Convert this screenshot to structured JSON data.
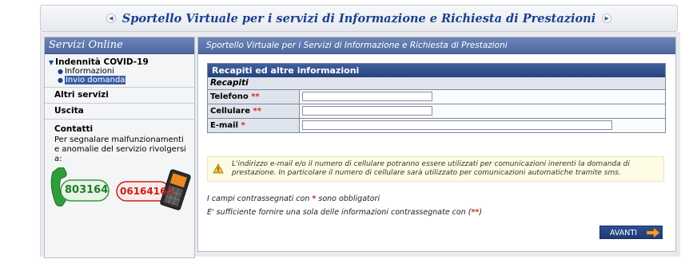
{
  "banner": {
    "title": "Sportello Virtuale per i servizi di Informazione e Richiesta di Prestazioni",
    "prev_icon": "chevron-left-icon",
    "next_icon": "chevron-right-icon"
  },
  "sidebar": {
    "header": "Servizi Online",
    "section": {
      "title": "Indennità COVID-19",
      "items": [
        {
          "label": "Informazioni",
          "active": false
        },
        {
          "label": "Invio domanda",
          "active": true
        }
      ]
    },
    "other_services": "Altri servizi",
    "exit": "Uscita",
    "contacts": {
      "title": "Contatti",
      "text": "Per segnalare malfunzionamenti e anomalie del servizio rivolgersi a:",
      "landline": "803164",
      "mobile": "06164164"
    }
  },
  "main": {
    "header": "Sportello Virtuale per i Servizi di Informazione e Richiesta di Prestazioni",
    "form": {
      "section_title": "Recapiti ed altre informazioni",
      "subsection_title": "Recapiti",
      "fields": [
        {
          "label": "Telefono",
          "marker": "**",
          "value": ""
        },
        {
          "label": "Cellulare",
          "marker": "**",
          "value": ""
        },
        {
          "label": "E-mail",
          "marker": "*",
          "value": ""
        }
      ]
    },
    "notice": "L'indirizzo e-mail e/o il numero di cellulare potranno essere utilizzati per comunicazioni inerenti la domanda di prestazione. In particolare il numero di cellulare sarà utilizzato per comunicazioni automatiche tramite sms.",
    "required_note": {
      "before": "I campi contrassegnati con ",
      "marker": "*",
      "after": " sono obbligatori"
    },
    "one_of_note": {
      "before": "E' sufficiente fornire una sola delle informazioni contrassegnate con (",
      "marker": "**",
      "after": ")"
    },
    "next_button": "AVANTI"
  },
  "colors": {
    "header_blue": "#50689e",
    "title_blue": "#1c3f8f",
    "required_red": "#d9261c",
    "button_blue": "#1f3b75"
  }
}
